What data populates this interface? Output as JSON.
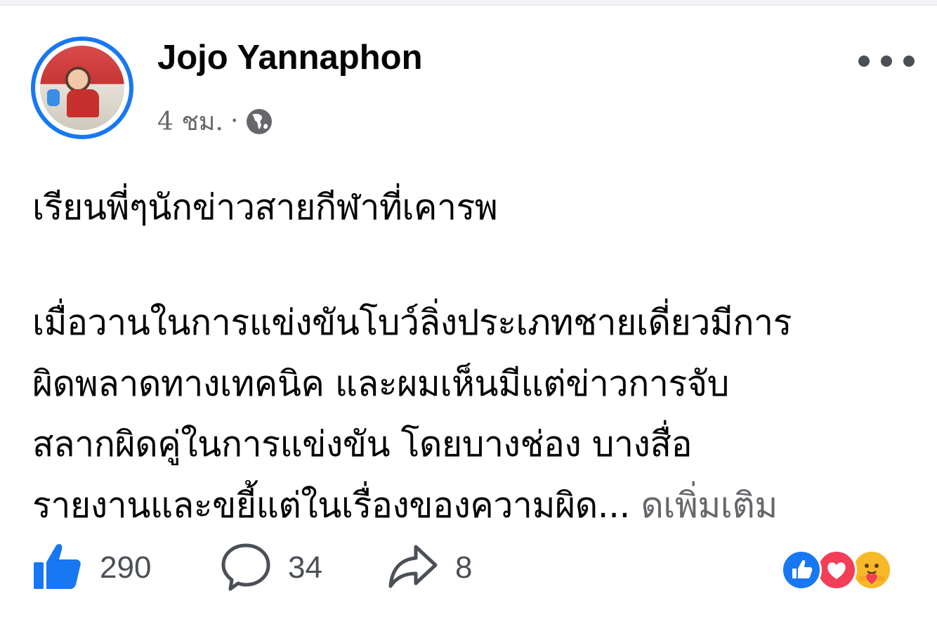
{
  "post": {
    "author": "Jojo Yannaphon",
    "time": "4 ชม.",
    "separator": "·",
    "privacy_icon": "globe-icon",
    "more_icon": "more-options-icon",
    "text": {
      "greeting": "เรียนพี่ๆนักข่าวสายกีฬาที่เคารพ",
      "line1": "เมื่อวานในการแข่งขันโบว์ลิ่งประเภทชายเดี่ยวมีการ",
      "line2": "ผิดพลาดทางเทคนิค และผมเห็นมีแต่ข่าวการจับ",
      "line3": "สลากผิดคู่ในการแข่งขัน โดยบางช่อง บางสื่อ",
      "line4": "รายงานและขยี้แต่ในเรื่องของความผิด...",
      "see_more": "ดเพิ่มเติม"
    },
    "stats": {
      "likes": "290",
      "comments": "34",
      "shares": "8"
    },
    "reactions": [
      "like",
      "love",
      "care"
    ],
    "colors": {
      "accent": "#1877f2",
      "love": "#f33e58",
      "care": "#f7b928",
      "secondary_text": "#65676b"
    }
  }
}
